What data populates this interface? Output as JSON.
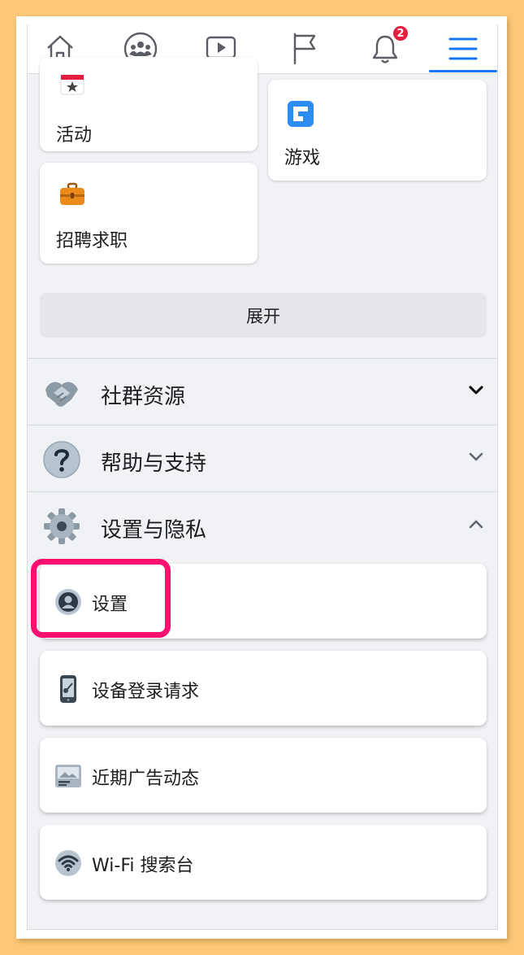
{
  "nav": {
    "tabs": [
      {
        "icon": "home-icon"
      },
      {
        "icon": "groups-icon"
      },
      {
        "icon": "watch-icon"
      },
      {
        "icon": "pages-flag-icon"
      },
      {
        "icon": "notifications-bell-icon",
        "badge": "2"
      },
      {
        "icon": "menu-icon",
        "active": true
      }
    ]
  },
  "shortcuts": {
    "events": {
      "label": "活动",
      "icon": "calendar-star-icon"
    },
    "gaming": {
      "label": "游戏",
      "icon": "gaming-icon"
    },
    "jobs": {
      "label": "招聘求职",
      "icon": "briefcase-icon"
    }
  },
  "expand_button": "展开",
  "sections": {
    "community": {
      "label": "社群资源",
      "icon": "handshake-icon",
      "expanded": false
    },
    "help": {
      "label": "帮助与支持",
      "icon": "question-icon",
      "expanded": false
    },
    "settings": {
      "label": "设置与隐私",
      "icon": "gear-icon",
      "expanded": true
    }
  },
  "settings_items": [
    {
      "label": "设置",
      "icon": "user-circle-icon"
    },
    {
      "label": "设备登录请求",
      "icon": "phone-key-icon"
    },
    {
      "label": "近期广告动态",
      "icon": "ad-image-icon"
    },
    {
      "label": "Wi-Fi 搜索台",
      "icon": "wifi-icon"
    }
  ],
  "colors": {
    "accent": "#1877f2",
    "highlight": "#ff0f6f",
    "badge": "#e41e3f"
  }
}
